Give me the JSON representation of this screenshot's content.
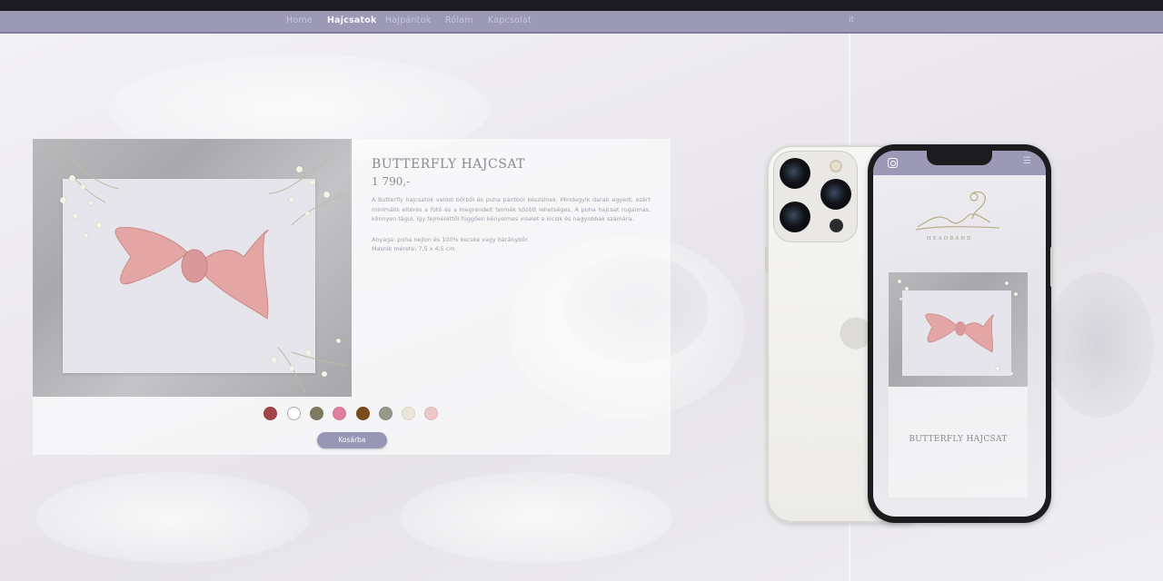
{
  "nav": {
    "items": [
      {
        "label": "Home",
        "active": false
      },
      {
        "label": "Hajcsatok",
        "active": true
      },
      {
        "label": "Hajpántok",
        "active": false
      },
      {
        "label": "Rólam",
        "active": false
      },
      {
        "label": "Kapcsolat",
        "active": false
      }
    ],
    "extra": "it"
  },
  "product": {
    "title": "BUTTERFLY HAJCSAT",
    "price": "1 790,-",
    "description": "A Butterfly hajcsatok valódi bőrből és puha pántból készülnek. Mindegyik darab egyedi, ezért minimális eltérés a fotó és a megrendelt termék között lehetséges. A puha hajcsat rugalmas, könnyen tágul, így fejméréttől függően kényelmes viselet a kicsik és nagyobbak számára.",
    "material": "Anyaga: puha nejlon és 100% kecske vagy báránybőr.",
    "size": "Masnik mérete: 7,5 x 4,5 cm",
    "swatches": [
      "#a2444a",
      "#ffffff",
      "#7d7c62",
      "#e07ea0",
      "#7a4b1c",
      "#97978a",
      "#ebe6da",
      "#eec7c9"
    ],
    "cart_label": "Kosárba"
  },
  "mobile": {
    "logo_text": "HEADBAND",
    "product_title": "BUTTERFLY HAJCSAT",
    "instagram_icon": "instagram-icon",
    "menu_icon": "hamburger-menu-icon"
  },
  "colors": {
    "nav_bg": "#9b99b5",
    "accent": "#9896b5",
    "bow": "#e3a6a4"
  }
}
